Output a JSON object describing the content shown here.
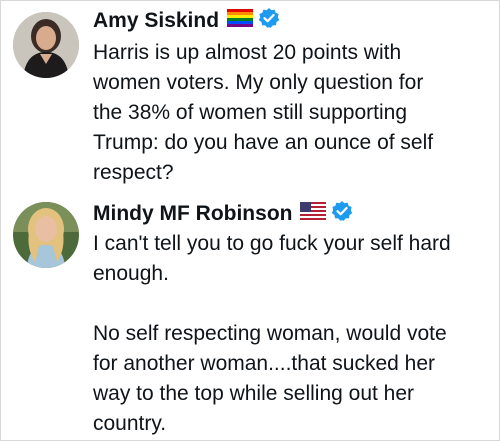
{
  "posts": [
    {
      "author": "Amy Siskind",
      "flag_icon": "rainbow-flag-icon",
      "verified_icon": "verified-badge-icon",
      "text": "Harris is up almost 20 points with\nwomen voters. My only question for\nthe 38% of women still supporting\nTrump:  do you have an ounce of self\nrespect?"
    },
    {
      "author": "Mindy MF Robinson",
      "flag_icon": "us-flag-icon",
      "verified_icon": "verified-badge-icon",
      "text": "I can't tell you to go fuck your self hard\nenough.\n\nNo self respecting woman, would vote\nfor another woman....that sucked her\nway to the top while selling out her\ncountry."
    }
  ],
  "colors": {
    "text": "#0f1419",
    "verified": "#1d9bf0",
    "border": "#d7d7d7"
  }
}
